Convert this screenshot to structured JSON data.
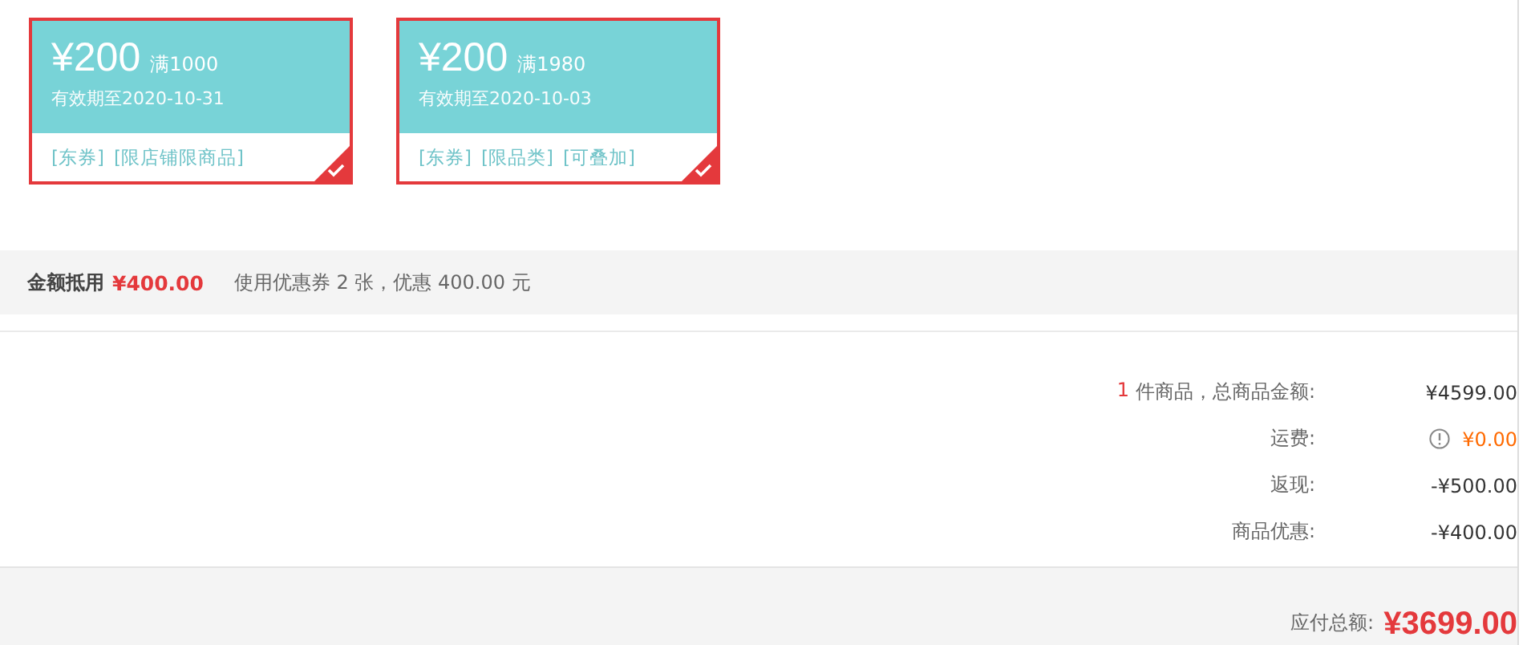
{
  "coupons": [
    {
      "amount": "¥200",
      "threshold": "满1000",
      "validity": "有效期至2020-10-31",
      "tags": [
        "[东券]",
        "[限店铺限商品]"
      ],
      "selected": true
    },
    {
      "amount": "¥200",
      "threshold": "满1980",
      "validity": "有效期至2020-10-03",
      "tags": [
        "[东券]",
        "[限品类]",
        "[可叠加]"
      ],
      "selected": true
    }
  ],
  "deduction": {
    "label": "金额抵用",
    "amount": "¥400.00",
    "note": "使用优惠券 2 张，优惠 400.00 元"
  },
  "summary": [
    {
      "kind": "plain",
      "count": "1",
      "label": "件商品，总商品金额:",
      "value": "¥4599.00"
    },
    {
      "kind": "shipping",
      "label": "运费:",
      "value": "¥0.00"
    },
    {
      "kind": "plain",
      "label": "返现:",
      "value": "-¥500.00"
    },
    {
      "kind": "plain",
      "label": "商品优惠:",
      "value": "-¥400.00"
    }
  ],
  "total": {
    "label": "应付总额:",
    "value": "¥3699.00"
  }
}
